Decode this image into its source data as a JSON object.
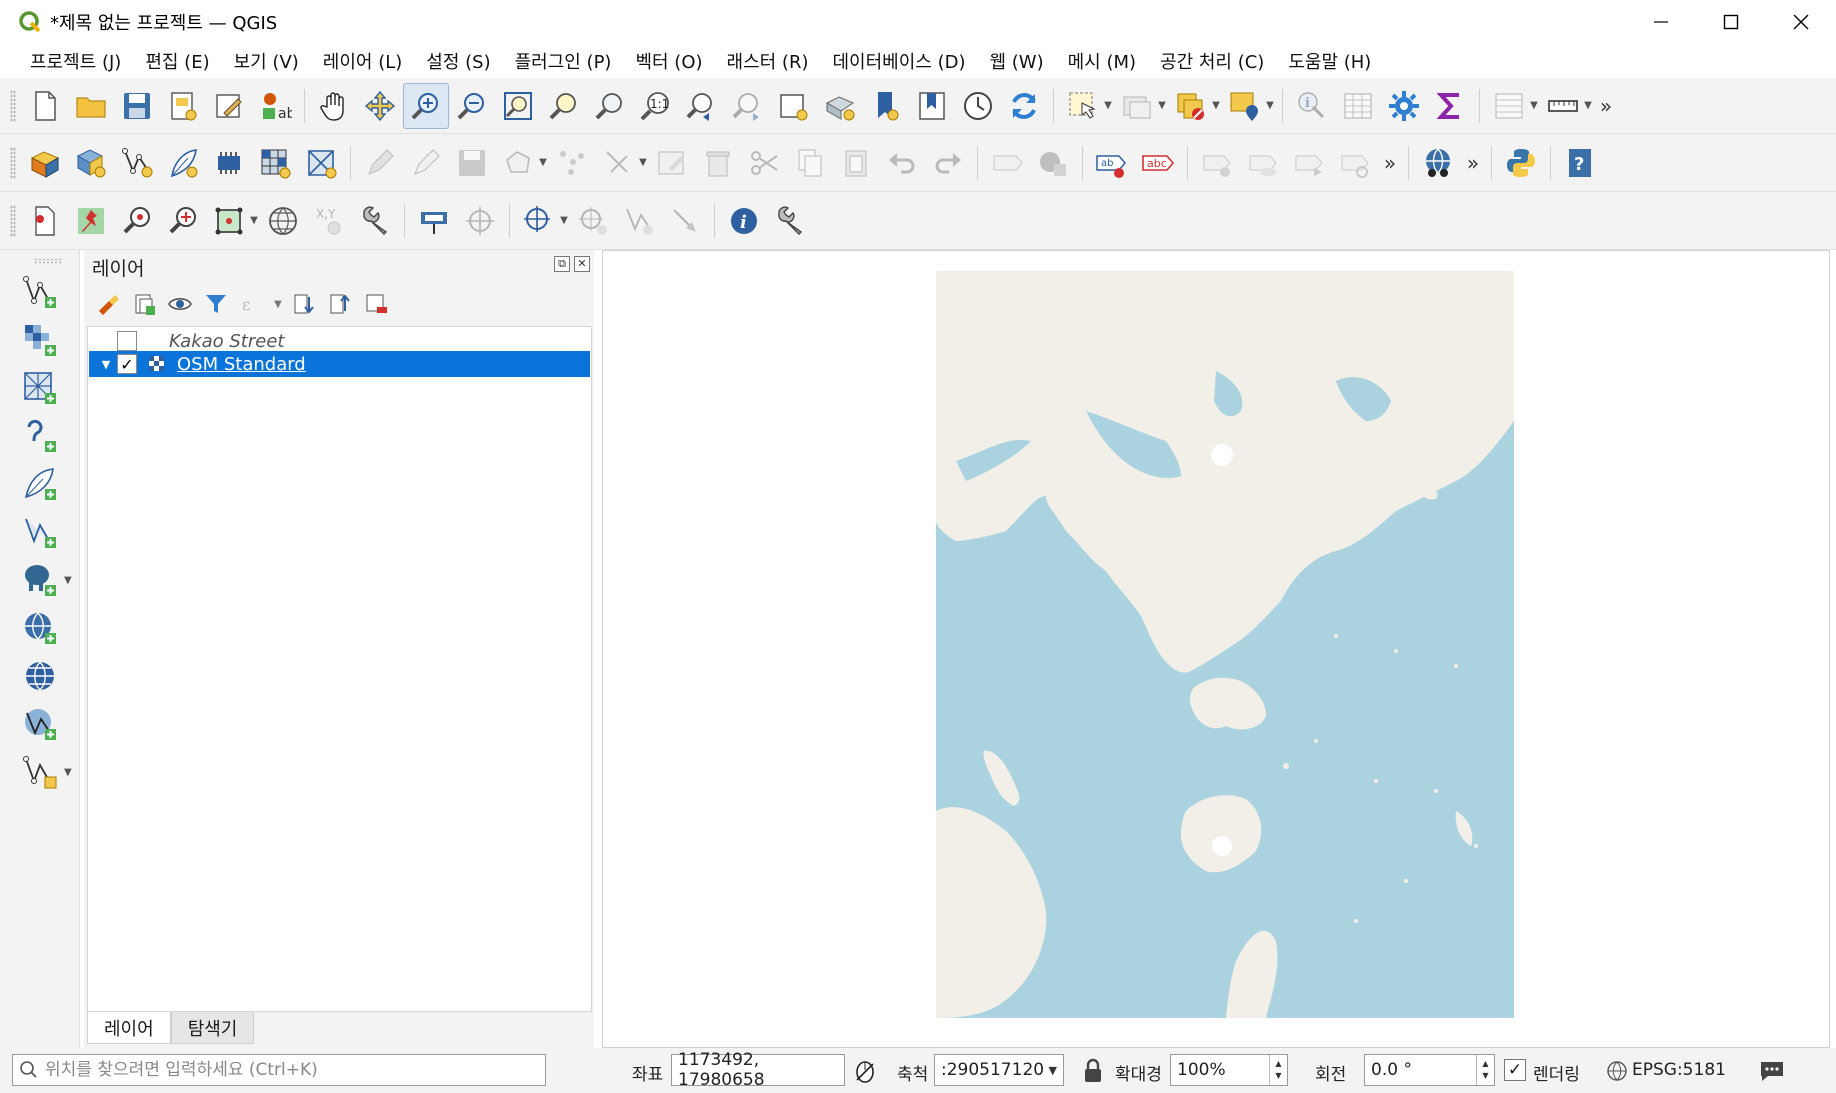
{
  "window": {
    "title": "*제목 없는 프로젝트 — QGIS"
  },
  "menu": [
    {
      "label": "프로젝트 (J)"
    },
    {
      "label": "편집 (E)"
    },
    {
      "label": "보기 (V)"
    },
    {
      "label": "레이어 (L)"
    },
    {
      "label": "설정 (S)"
    },
    {
      "label": "플러그인 (P)"
    },
    {
      "label": "벡터 (O)"
    },
    {
      "label": "래스터 (R)"
    },
    {
      "label": "데이터베이스 (D)"
    },
    {
      "label": "웹 (W)"
    },
    {
      "label": "메시 (M)"
    },
    {
      "label": "공간 처리 (C)"
    },
    {
      "label": "도움말 (H)"
    }
  ],
  "toolbar_labels": {
    "abc1": "abc",
    "abc2": "abc",
    "one_to_one": "1:1",
    "xy": "X,Y"
  },
  "layers_panel": {
    "title": "레이어",
    "layers": [
      {
        "name": "Kakao Street",
        "checked": false,
        "selected": false
      },
      {
        "name": "OSM Standard",
        "checked": true,
        "selected": true
      }
    ],
    "tabs": [
      "레이어",
      "탐색기"
    ]
  },
  "statusbar": {
    "locator_placeholder": "위치를 찾으려면 입력하세요 (Ctrl+K)",
    "coordinate_label": "좌표",
    "coordinate_value": "1173492, 17980658",
    "scale_label": "축척",
    "scale_value": ":290517120",
    "magnifier_label": "확대경",
    "magnifier_value": "100%",
    "rotation_label": "회전",
    "rotation_value": "0.0 °",
    "render_label": "렌더링",
    "crs": "EPSG:5181"
  },
  "colors": {
    "selection": "#0a74da",
    "sea": "#aad3df",
    "land": "#f2efe9"
  }
}
